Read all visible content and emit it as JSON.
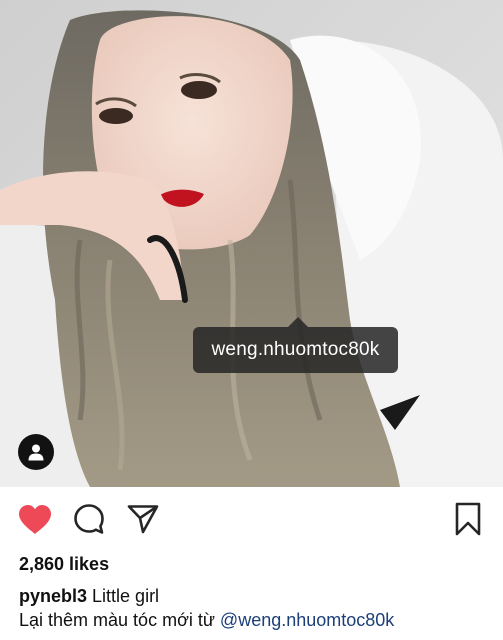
{
  "post": {
    "photo_alt": "photo",
    "tag_username": "weng.nhuomtoc80k",
    "likes": "2,860 likes",
    "caption_user": "pynebl3",
    "caption_text": " Little girl",
    "comment_text": "Lại thêm màu tóc mới từ ",
    "comment_mention": "@weng.nhuomtoc80k",
    "liked": true
  },
  "icons": {
    "like": "heart-icon",
    "comment": "comment-icon",
    "share": "paper-plane-icon",
    "save": "bookmark-icon",
    "user_tags": "person-icon"
  },
  "colors": {
    "heart": "#ed4956",
    "mention": "#1c3f7a",
    "tag_background": "#262626"
  }
}
